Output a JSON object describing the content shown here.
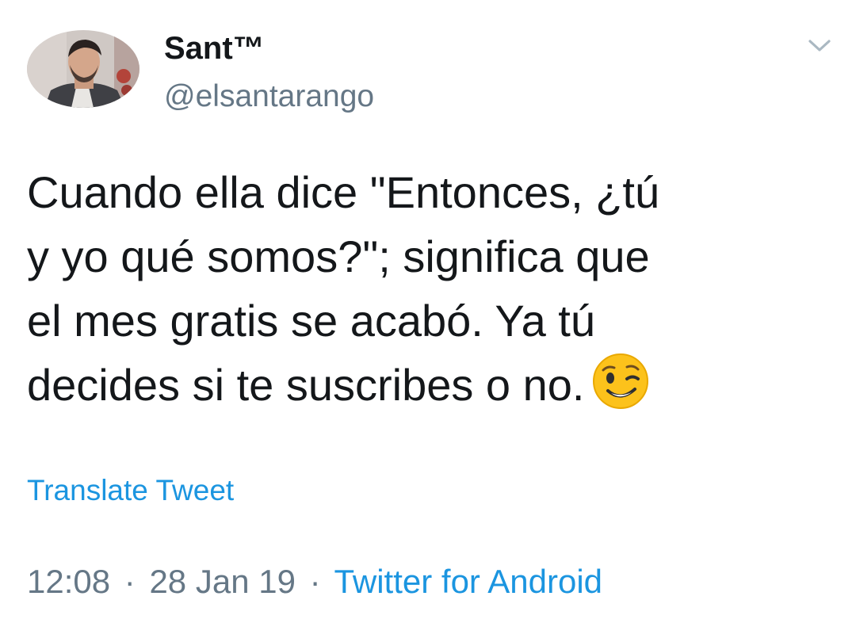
{
  "tweet": {
    "author": {
      "display_name": "Sant™",
      "handle": "@elsantarango",
      "avatar_icon": "user-avatar-photo"
    },
    "menu_icon": "chevron-down-icon",
    "text_lines": [
      "Cuando ella dice \"Entonces, ¿tú",
      "y yo qué somos?\"; significa que",
      "el mes gratis se acabó. Ya tú",
      "decides si te suscribes o no."
    ],
    "emoji": "winking-face-emoji",
    "translate_label": "Translate Tweet",
    "time": "12:08",
    "date": "28 Jan 19",
    "separator": "·",
    "source": "Twitter for Android"
  },
  "colors": {
    "text": "#14171a",
    "secondary": "#657786",
    "link": "#1b95e0",
    "background": "#ffffff"
  }
}
